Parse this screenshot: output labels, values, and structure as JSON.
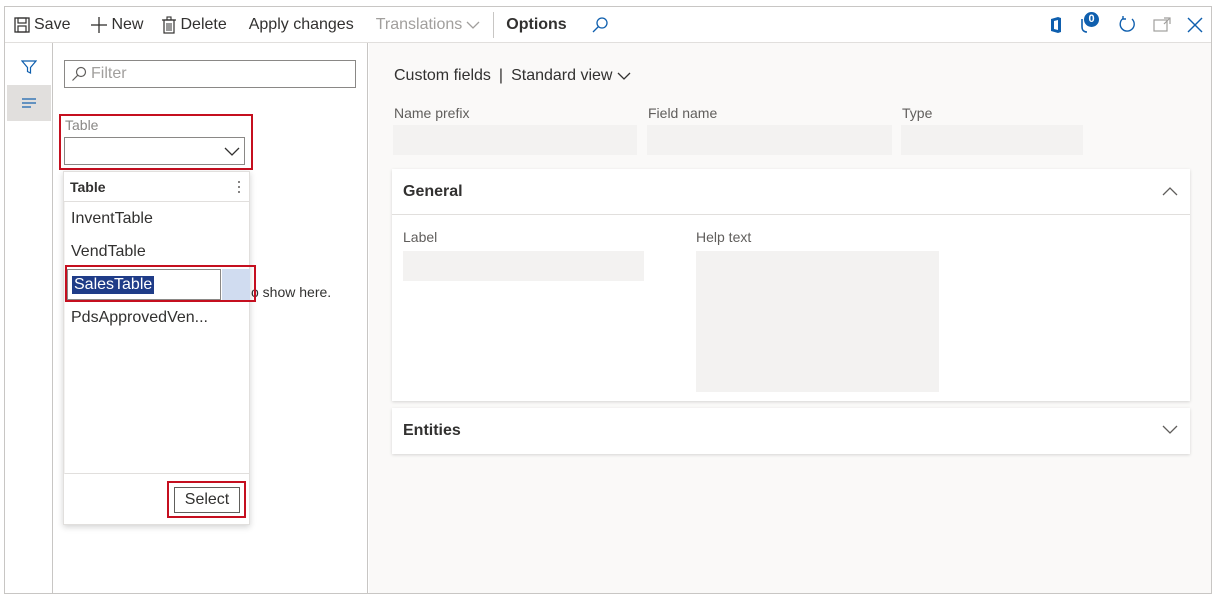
{
  "toolbar": {
    "save": "Save",
    "new": "New",
    "delete": "Delete",
    "apply_changes": "Apply changes",
    "translations": "Translations",
    "options": "Options",
    "attachments_count": "0"
  },
  "list_pane": {
    "filter_placeholder": "Filter",
    "empty_text": "o show here."
  },
  "table_lookup": {
    "label": "Table",
    "value": "",
    "column_header": "Table",
    "items": [
      "InventTable",
      "VendTable",
      "SalesTable",
      "PdsApprovedVen..."
    ],
    "selected_item": "SalesTable",
    "select_button": "Select"
  },
  "detail": {
    "breadcrumb": {
      "page": "Custom fields",
      "separator": "|",
      "view": "Standard view"
    },
    "fields": {
      "name_prefix": "Name prefix",
      "field_name": "Field name",
      "type": "Type"
    },
    "general": {
      "title": "General",
      "label": "Label",
      "help_text": "Help text"
    },
    "entities": {
      "title": "Entities"
    }
  },
  "colors": {
    "highlight_border": "#c50f1f",
    "selection_bg": "#1f3c88",
    "badge_bg": "#0f5fae"
  }
}
